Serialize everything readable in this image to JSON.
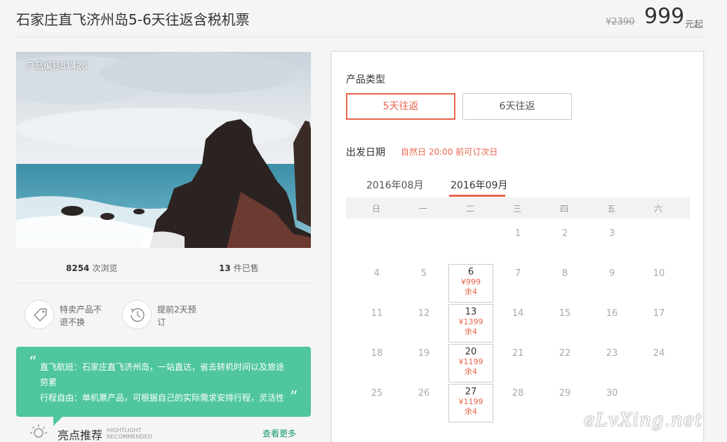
{
  "header": {
    "title": "石家庄直飞济州岛5-6天往返含税机票",
    "original_price": "¥2390",
    "price": "999",
    "price_unit": "元起"
  },
  "product": {
    "code_label": "产品编号81428",
    "views_count": "8254",
    "views_label": "次浏览",
    "sold_count": "13",
    "sold_label": "件已售"
  },
  "features": [
    {
      "icon": "tag-icon",
      "line1": "特卖产品不",
      "line2": "退不换"
    },
    {
      "icon": "clock-icon",
      "line1": "提前2天预",
      "line2": "订"
    }
  ],
  "quote": {
    "line1": "直飞航班：石家庄直飞济州岛，一站直达，省去转机时间以及旅途",
    "line2": "劳累",
    "line3": "行程自由：单机票产品，可根据自己的实际需求安排行程，灵活性"
  },
  "highlights": {
    "label": "亮点推荐",
    "en1": "HIGHTLIGHT",
    "en2": "RECOMMENDED",
    "more": "查看更多"
  },
  "booking": {
    "type_label": "产品类型",
    "options": [
      "5天往返",
      "6天往返"
    ],
    "selected_option": "5天往返",
    "departure_label": "出发日期",
    "departure_note": "自然日 20:00 前可订次日",
    "months": [
      "2016年08月",
      "2016年09月"
    ],
    "selected_month": "2016年09月",
    "weekdays": [
      "日",
      "一",
      "二",
      "三",
      "四",
      "五",
      "六"
    ]
  },
  "calendar": {
    "rows": [
      [
        null,
        null,
        null,
        {
          "d": "1"
        },
        {
          "d": "2"
        },
        {
          "d": "3"
        },
        null
      ],
      [
        {
          "d": "4"
        },
        {
          "d": "5"
        },
        {
          "d": "6",
          "price": "¥999",
          "left": "余4"
        },
        {
          "d": "7"
        },
        {
          "d": "8"
        },
        {
          "d": "9"
        },
        {
          "d": "10"
        }
      ],
      [
        {
          "d": "11"
        },
        {
          "d": "12"
        },
        {
          "d": "13",
          "price": "¥1399",
          "left": "余4"
        },
        {
          "d": "14"
        },
        {
          "d": "15"
        },
        {
          "d": "16"
        },
        {
          "d": "17"
        }
      ],
      [
        {
          "d": "18"
        },
        {
          "d": "19"
        },
        {
          "d": "20",
          "price": "¥1199",
          "left": "余4"
        },
        {
          "d": "21"
        },
        {
          "d": "22"
        },
        {
          "d": "23"
        },
        {
          "d": "24"
        }
      ],
      [
        {
          "d": "25"
        },
        {
          "d": "26"
        },
        {
          "d": "27",
          "price": "¥1199",
          "left": "余4"
        },
        {
          "d": "28"
        },
        {
          "d": "29"
        },
        {
          "d": "30"
        },
        null
      ]
    ]
  },
  "colors": {
    "accent": "#e8664c",
    "quote_bg": "#4fc6a0",
    "link": "#159a72"
  },
  "watermark": "eLvXing.net"
}
